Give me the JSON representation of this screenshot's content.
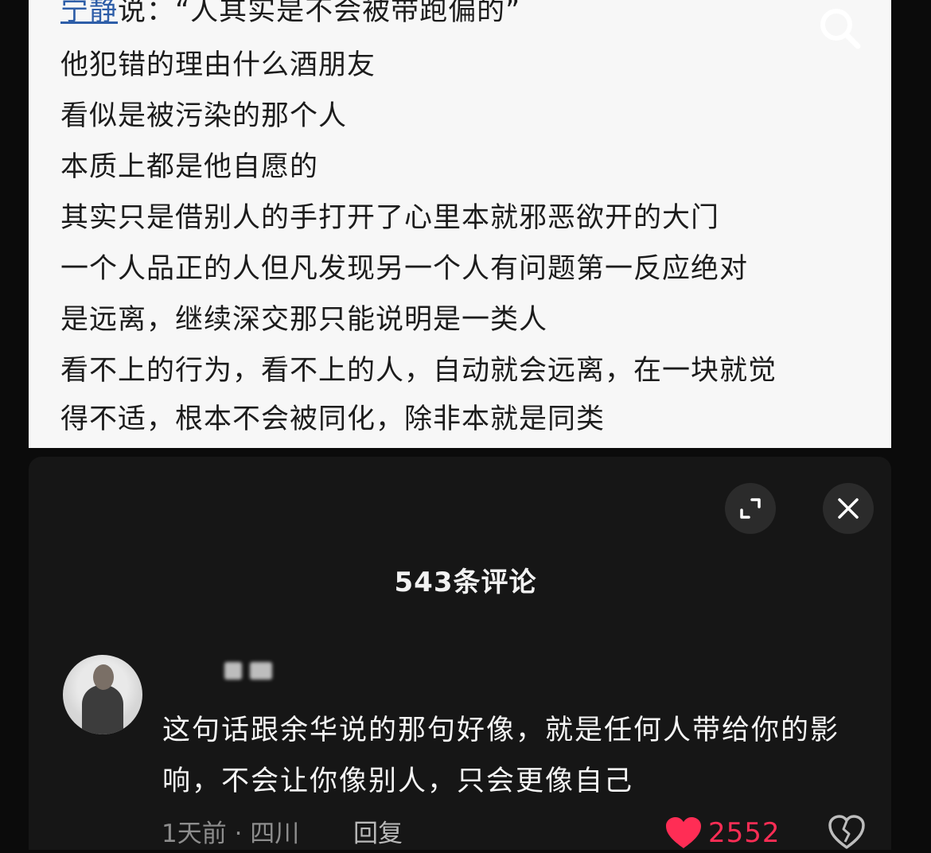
{
  "quote_card": {
    "author": "宁静",
    "author_rest": "说：“人其实是不会被带跑偏的”",
    "lines": [
      "他犯错的理由什么酒朋友",
      "看似是被污染的那个人",
      "本质上都是他自愿的",
      "其实只是借别人的手打开了心里本就邪恶欲开的大门",
      " 一个人品正的人但凡发现另一个人有问题第一反应绝对",
      "是远离，继续深交那只能说明是一类人",
      "看不上的行为，看不上的人，自动就会远离，在一块就觉",
      "得不适，根本不会被同化，除非本就是同类"
    ],
    "search_icon": "search-icon"
  },
  "comments_panel": {
    "title": "543条评论",
    "expand_icon": "expand-icon",
    "close_icon": "close-icon",
    "comment": {
      "text": "这句话跟余华说的那句好像，就是任何人带给你的影响，不会让你像别人，只会更像自己",
      "meta": "1天前 · 四川",
      "reply_label": "回复",
      "like_count": "2552",
      "like_color": "#ff2d55"
    }
  }
}
